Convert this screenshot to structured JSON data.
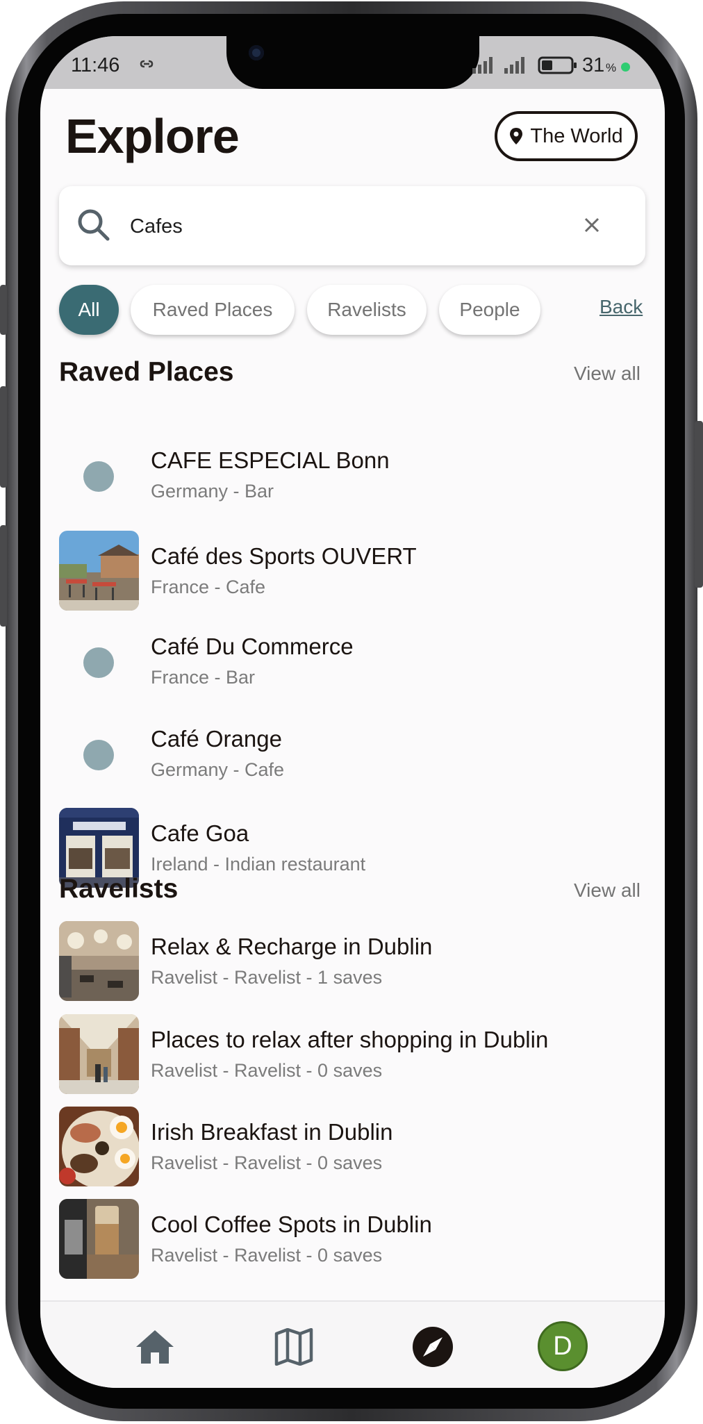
{
  "status_bar": {
    "time": "11:46",
    "battery": "31",
    "battery_unit": "%"
  },
  "header": {
    "title": "Explore",
    "location_button": "The World"
  },
  "search": {
    "value": "Cafes",
    "icon": "search-icon",
    "clear_icon": "close-icon"
  },
  "filters": {
    "chips": [
      "All",
      "Raved Places",
      "Ravelists",
      "People"
    ],
    "selected": "All",
    "back_link": "Back"
  },
  "raved_places": {
    "title": "Raved Places",
    "view_all": "View all",
    "items": [
      {
        "name": "CAFE ESPECIAL Bonn",
        "subtitle": "Germany - Bar",
        "image": "placeholder-dot"
      },
      {
        "name": "Café des Sports OUVERT",
        "subtitle": "France - Cafe",
        "image": "outdoor-terrace-photo"
      },
      {
        "name": "Café Du Commerce",
        "subtitle": "France - Bar",
        "image": "placeholder-dot"
      },
      {
        "name": "Café Orange",
        "subtitle": "Germany - Cafe",
        "image": "placeholder-dot"
      },
      {
        "name": "Cafe Goa",
        "subtitle": "Ireland - Indian restaurant",
        "image": "storefront-photo"
      }
    ]
  },
  "ravelists": {
    "title": "Ravelists",
    "view_all": "View all",
    "items": [
      {
        "name": "Relax & Recharge in Dublin",
        "subtitle": "Ravelist - Ravelist - 1 saves",
        "image": "interior-lamps-photo"
      },
      {
        "name": "Places to relax after shopping in Dublin",
        "subtitle": "Ravelist - Ravelist - 0 saves",
        "image": "shopping-arcade-photo"
      },
      {
        "name": "Irish Breakfast in Dublin",
        "subtitle": "Ravelist - Ravelist - 0 saves",
        "image": "breakfast-plate-photo"
      },
      {
        "name": "Cool Coffee Spots in Dublin",
        "subtitle": "Ravelist - Ravelist - 0 saves",
        "image": "iced-coffee-photo"
      }
    ]
  },
  "bottom_nav": {
    "items": [
      "home-icon",
      "map-icon",
      "compass-icon",
      "profile-avatar"
    ],
    "active": "compass-icon",
    "avatar_initial": "D"
  },
  "colors": {
    "accent": "#3a6b73",
    "placeholder": "#8fa8af",
    "avatar": "#5a8f2f",
    "title_text": "#1b1411"
  }
}
